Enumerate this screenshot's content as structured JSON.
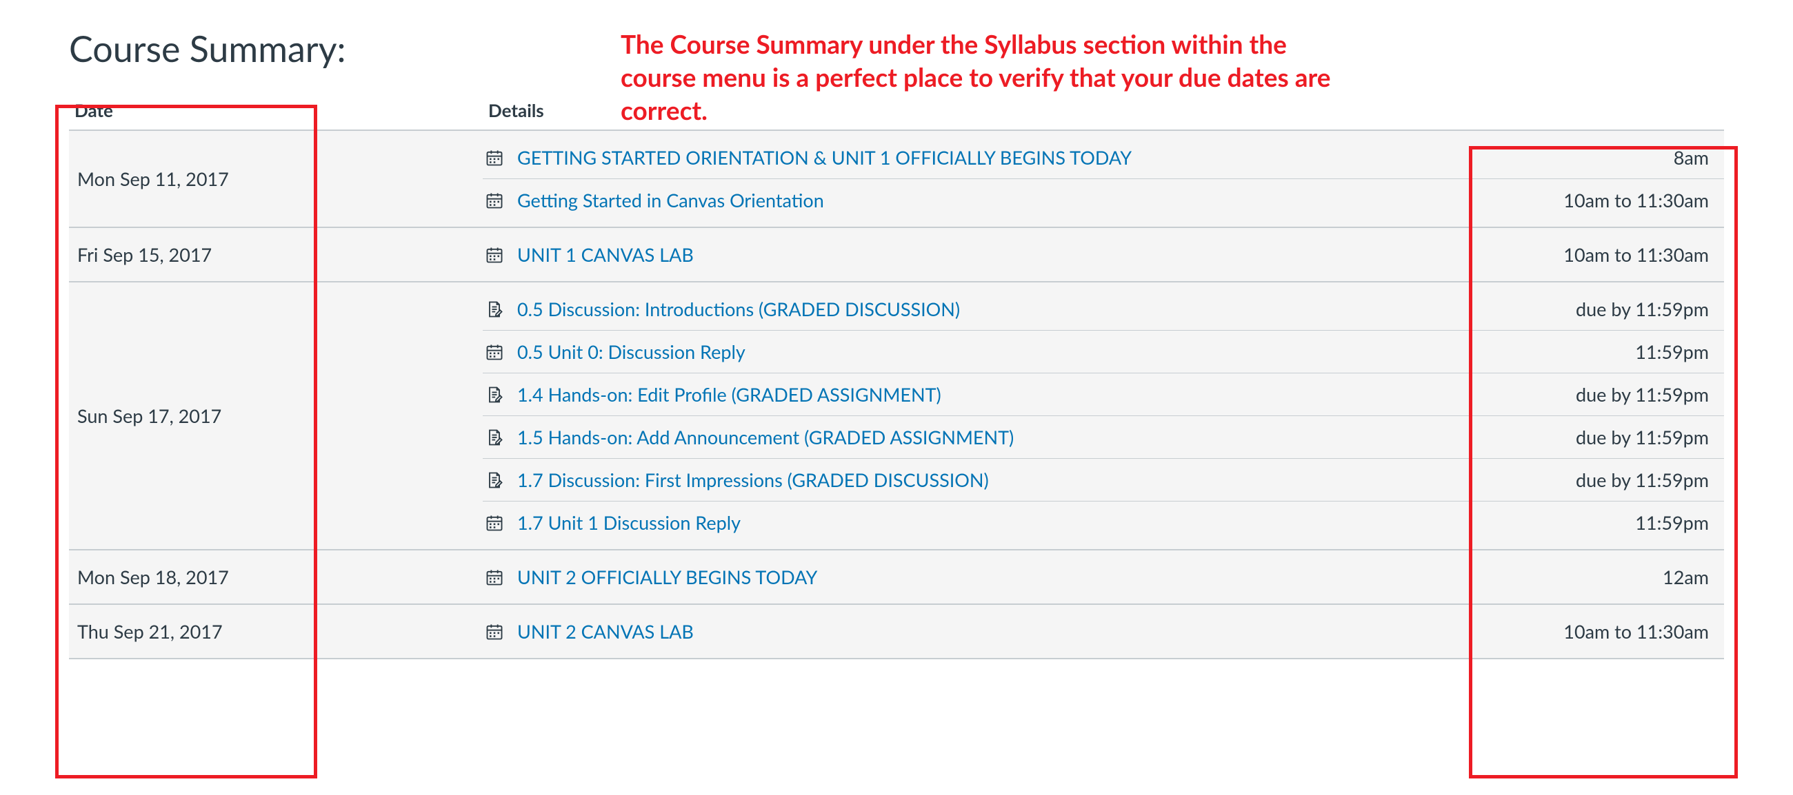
{
  "title": "Course Summary:",
  "annotation": "The Course Summary under the Syllabus section within the course menu is a perfect place to verify that your due dates are correct.",
  "headers": {
    "date": "Date",
    "details": "Details"
  },
  "days": [
    {
      "date": "Mon Sep 11, 2017",
      "items": [
        {
          "icon": "calendar",
          "title": "GETTING STARTED ORIENTATION & UNIT 1 OFFICIALLY BEGINS TODAY",
          "time": "8am"
        },
        {
          "icon": "calendar",
          "title": "Getting Started in Canvas Orientation",
          "time": "10am to 11:30am"
        }
      ]
    },
    {
      "date": "Fri Sep 15, 2017",
      "items": [
        {
          "icon": "calendar",
          "title": "UNIT 1 CANVAS LAB",
          "time": "10am to 11:30am"
        }
      ]
    },
    {
      "date": "Sun Sep 17, 2017",
      "items": [
        {
          "icon": "assignment",
          "title": "0.5 Discussion: Introductions (GRADED DISCUSSION)",
          "time": "due by 11:59pm"
        },
        {
          "icon": "calendar",
          "title": "0.5 Unit 0: Discussion Reply",
          "time": "11:59pm"
        },
        {
          "icon": "assignment",
          "title": "1.4 Hands-on: Edit Profile (GRADED ASSIGNMENT)",
          "time": "due by 11:59pm"
        },
        {
          "icon": "assignment",
          "title": "1.5 Hands-on: Add Announcement (GRADED ASSIGNMENT)",
          "time": "due by 11:59pm"
        },
        {
          "icon": "assignment",
          "title": "1.7 Discussion: First Impressions (GRADED DISCUSSION)",
          "time": "due by 11:59pm"
        },
        {
          "icon": "calendar",
          "title": "1.7 Unit 1 Discussion Reply",
          "time": "11:59pm"
        }
      ]
    },
    {
      "date": "Mon Sep 18, 2017",
      "items": [
        {
          "icon": "calendar",
          "title": "UNIT 2 OFFICIALLY BEGINS TODAY",
          "time": "12am"
        }
      ]
    },
    {
      "date": "Thu Sep 21, 2017",
      "items": [
        {
          "icon": "calendar",
          "title": "UNIT 2 CANVAS LAB",
          "time": "10am to 11:30am"
        }
      ]
    }
  ]
}
